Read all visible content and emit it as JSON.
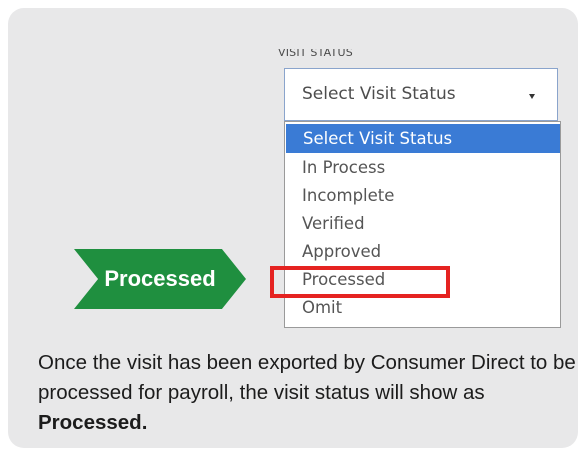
{
  "visit_status": {
    "label": "VISIT STATUS",
    "selected_value": "Select Visit Status",
    "options": [
      {
        "label": "Select Visit Status",
        "selected": true
      },
      {
        "label": "In Process",
        "selected": false
      },
      {
        "label": "Incomplete",
        "selected": false
      },
      {
        "label": "Verified",
        "selected": false
      },
      {
        "label": "Approved",
        "selected": false
      },
      {
        "label": "Processed",
        "selected": false
      },
      {
        "label": "Omit",
        "selected": false
      }
    ]
  },
  "callout": {
    "label": "Processed",
    "color": "#1f8f3f",
    "highlight_color": "#e52321"
  },
  "caption": {
    "text": "Once the visit has been exported by Consumer Direct to be processed for payroll, the visit status will show as ",
    "bold": "Processed."
  },
  "colors": {
    "card_background": "#e8e8e9",
    "selected_option": "#3a7bd5"
  }
}
